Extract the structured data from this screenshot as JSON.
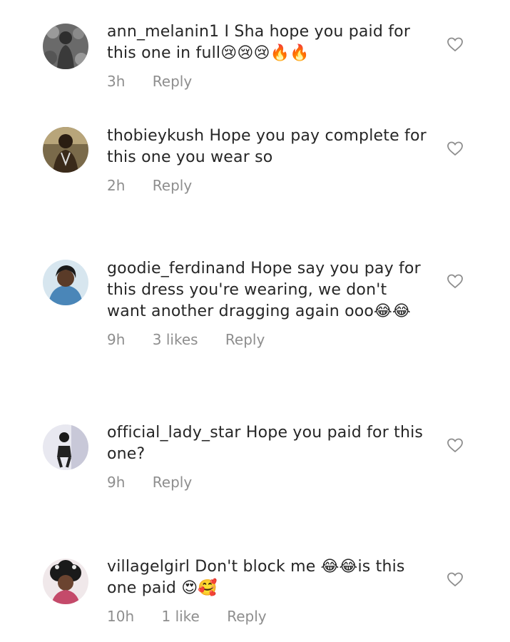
{
  "comments": [
    {
      "username": "ann_melanin1",
      "text": "I Sha hope you paid for this one in full😢😢😢🔥🔥",
      "time": "3h",
      "likes": "",
      "reply": "Reply"
    },
    {
      "username": "thobieykush",
      "text": "Hope you pay complete for this one you wear so",
      "time": "2h",
      "likes": "",
      "reply": "Reply"
    },
    {
      "username": "goodie_ferdinand",
      "text": "Hope say you pay for this dress you're wearing, we don't want another dragging again ooo😂😂",
      "time": "9h",
      "likes": "3 likes",
      "reply": "Reply"
    },
    {
      "username": "official_lady_star",
      "text": "Hope you paid for this one?",
      "time": "9h",
      "likes": "",
      "reply": "Reply"
    },
    {
      "username": "villagelgirl",
      "text": "Don't block me 😂😂is this one paid 😍🥰",
      "time": "10h",
      "likes": "1 like",
      "reply": "Reply"
    }
  ],
  "icons": {
    "like": "heart-outline-icon"
  }
}
